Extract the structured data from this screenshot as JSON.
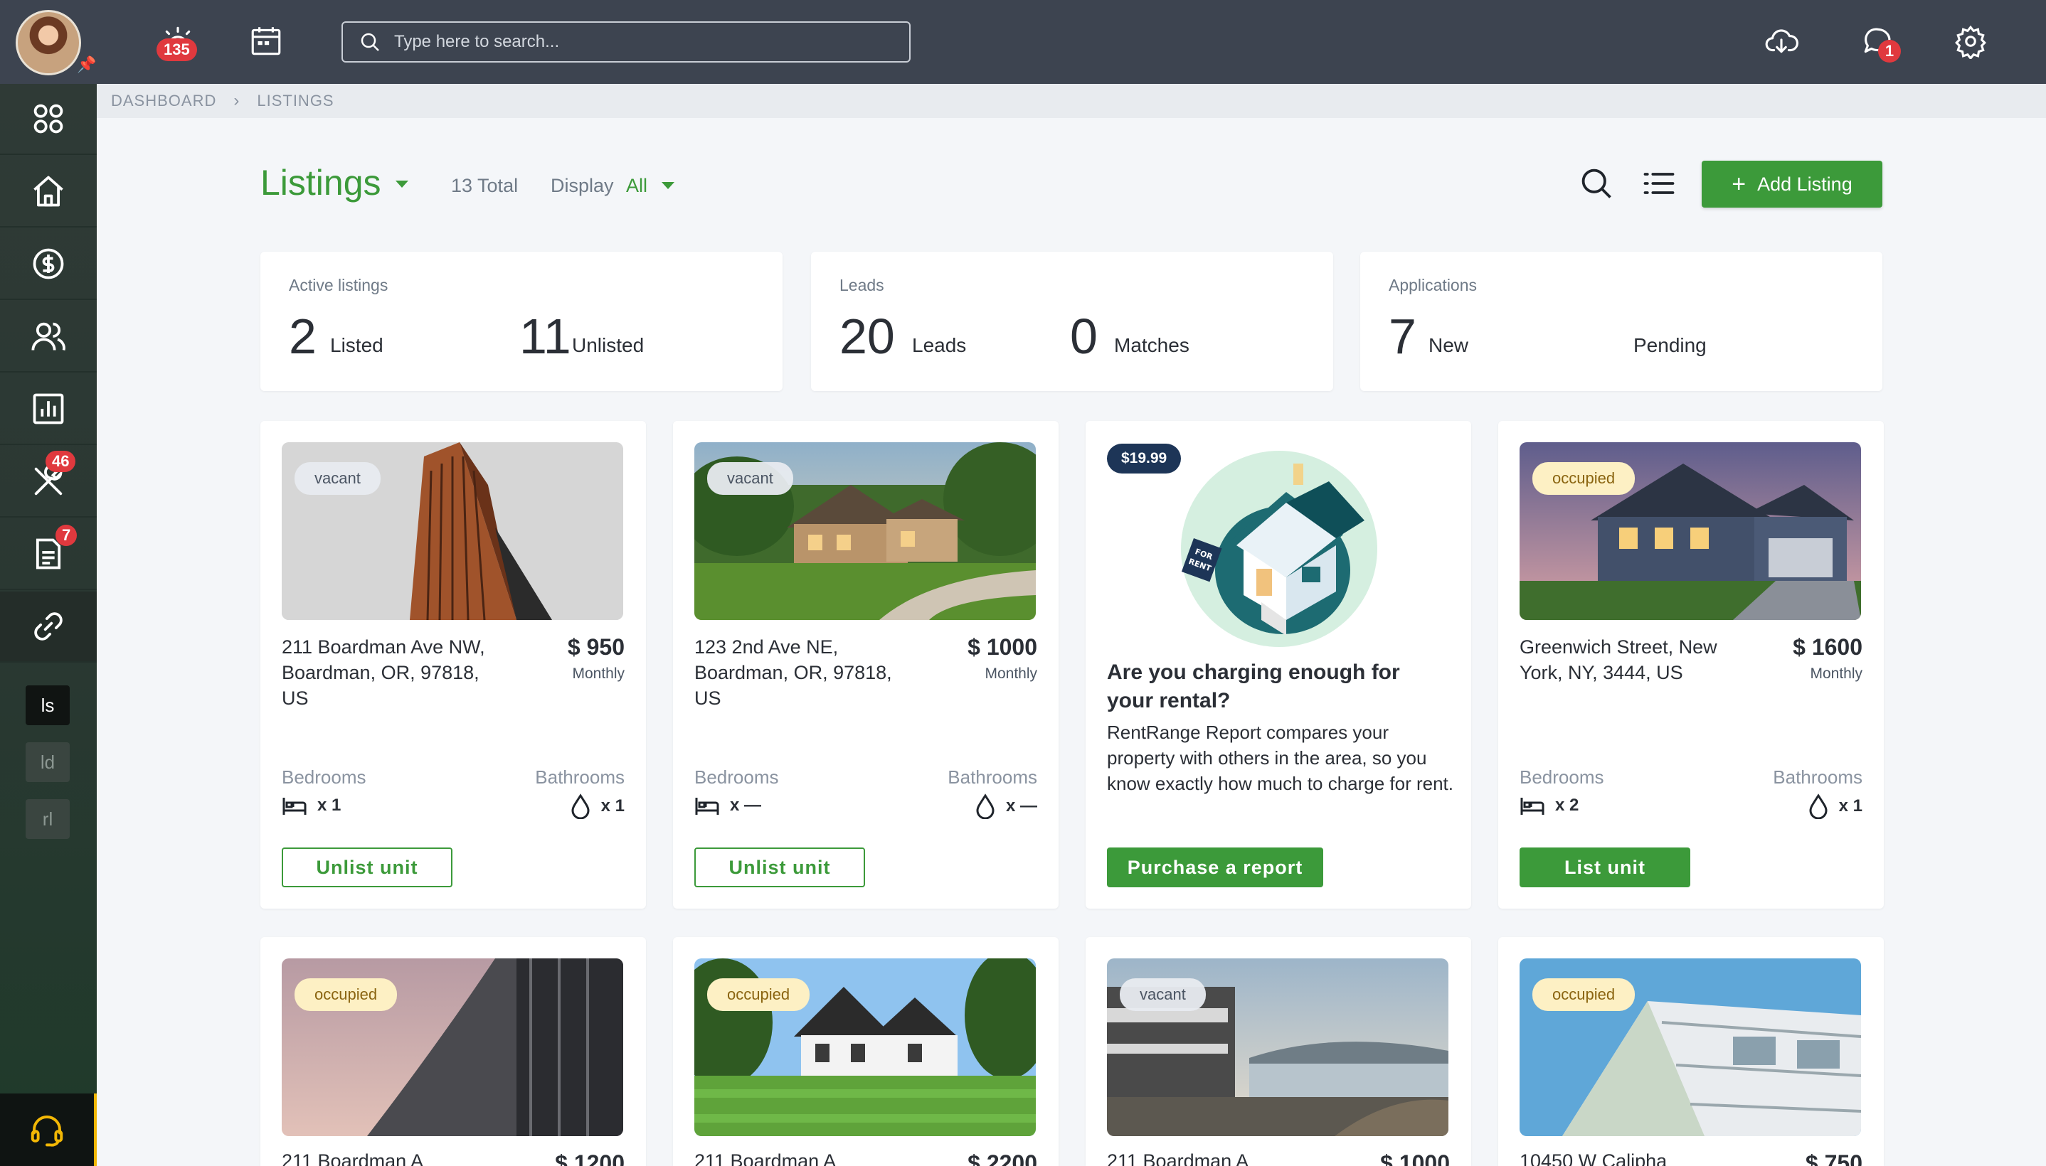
{
  "topbar": {
    "alerts_badge": "135",
    "search_placeholder": "Type here to search...",
    "messages_badge": "1"
  },
  "sidebar": {
    "items": [
      {
        "icon": "apps-icon"
      },
      {
        "icon": "home-icon"
      },
      {
        "icon": "dollar-icon"
      },
      {
        "icon": "users-icon"
      },
      {
        "icon": "chart-icon"
      },
      {
        "icon": "tools-icon",
        "badge": "46"
      },
      {
        "icon": "document-icon",
        "badge": "7"
      },
      {
        "icon": "link-icon"
      }
    ],
    "mini_tabs": [
      "ls",
      "ld",
      "rl"
    ]
  },
  "breadcrumb": [
    "DASHBOARD",
    "LISTINGS"
  ],
  "header": {
    "title": "Listings",
    "total": "13 Total",
    "display_label": "Display",
    "display_value": "All",
    "add_button": "Add Listing"
  },
  "stats": [
    {
      "title": "Active listings",
      "items": [
        {
          "num": "2",
          "label": "Listed"
        },
        {
          "num": "11",
          "label": "Unlisted"
        }
      ]
    },
    {
      "title": "Leads",
      "items": [
        {
          "num": "20",
          "label": "Leads"
        },
        {
          "num": "0",
          "label": "Matches"
        }
      ]
    },
    {
      "title": "Applications",
      "items": [
        {
          "num": "7",
          "label": "New"
        },
        {
          "num": "",
          "label": "Pending"
        }
      ]
    }
  ],
  "listings": [
    {
      "status": "vacant",
      "address": "211 Boardman Ave NW, Boardman, OR, 97818, US",
      "price": "$ 950",
      "period": "Monthly",
      "bedrooms_label": "Bedrooms",
      "bathrooms_label": "Bathrooms",
      "bedrooms": "x 1",
      "bathrooms": "x 1",
      "action": "Unlist unit"
    },
    {
      "status": "vacant",
      "address": "123 2nd Ave NE, Boardman, OR, 97818, US",
      "price": "$ 1000",
      "period": "Monthly",
      "bedrooms_label": "Bedrooms",
      "bathrooms_label": "Bathrooms",
      "bedrooms": "x —",
      "bathrooms": "x —",
      "action": "Unlist unit"
    },
    {
      "status": "occupied",
      "address": "Greenwich Street, New York, NY, 3444, US",
      "price": "$ 1600",
      "period": "Monthly",
      "bedrooms_label": "Bedrooms",
      "bathrooms_label": "Bathrooms",
      "bedrooms": "x 2",
      "bathrooms": "x 1",
      "action": "List unit"
    }
  ],
  "promo": {
    "price_tag": "$19.99",
    "heading": "Are you charging enough for your rental?",
    "body": "RentRange Report compares your property with others in the area, so you know exactly how much to charge for rent.",
    "button": "Purchase a report",
    "sign_text": "FOR RENT"
  },
  "second_row": [
    {
      "status": "occupied",
      "address_partial": "211 Boardman A",
      "price_partial": "$ 1200"
    },
    {
      "status": "occupied",
      "address_partial": "211 Boardman A",
      "price_partial": "$ 2200"
    },
    {
      "status": "vacant",
      "address_partial": "211 Boardman A",
      "price_partial": "$ 1000"
    },
    {
      "status": "occupied",
      "address_partial": "10450 W Calipha",
      "price_partial": "$ 750"
    }
  ],
  "colors": {
    "accent_green": "#3c9a3a",
    "topbar": "#3d4450",
    "badge_red": "#e0393e",
    "support_yellow": "#f2b705"
  }
}
